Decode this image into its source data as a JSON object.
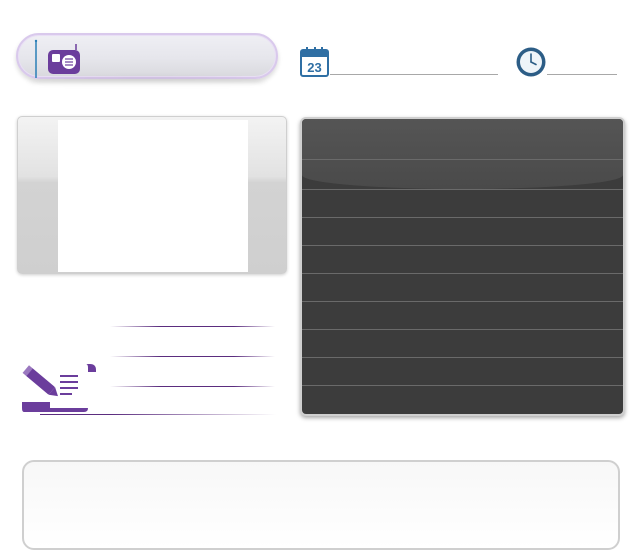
{
  "header": {
    "radio_label": "",
    "date_text": "",
    "time_text": "",
    "icons": {
      "radio": "radio-icon",
      "calendar": "calendar-icon",
      "calendar_day": "23",
      "clock": "clock-icon"
    }
  },
  "media": {
    "screen_text": ""
  },
  "notes": {
    "icon": "notes-pencil-icon",
    "lines": [
      "",
      "",
      ""
    ]
  },
  "list": {
    "rows": [
      "",
      "",
      "",
      "",
      "",
      "",
      "",
      "",
      ""
    ]
  },
  "bottom": {
    "text": ""
  },
  "colors": {
    "accent_purple": "#5b2d7f",
    "radio_purple": "#6b3d9c",
    "calendar_blue": "#2f6fa4",
    "clock_blue": "#2c5d86",
    "dark_panel": "#3c3c3c"
  }
}
